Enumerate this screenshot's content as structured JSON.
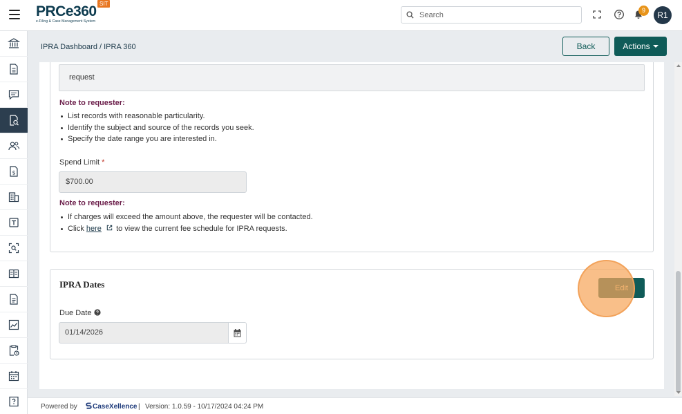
{
  "header": {
    "logo_text": "PRCe360",
    "logo_subtitle": "e-Filing & Case Management System",
    "env_badge": "SIT",
    "search_placeholder": "Search",
    "notification_count": "9",
    "avatar_initials": "R1"
  },
  "sidebar": {
    "items": [
      {
        "name": "sidebar-item-institution",
        "icon": "bank-icon"
      },
      {
        "name": "sidebar-item-documents",
        "icon": "document-icon"
      },
      {
        "name": "sidebar-item-messages",
        "icon": "chat-icon"
      },
      {
        "name": "sidebar-item-ipra",
        "icon": "file-search-icon",
        "active": true
      },
      {
        "name": "sidebar-item-users",
        "icon": "users-icon"
      },
      {
        "name": "sidebar-item-fees",
        "icon": "dollar-file-icon"
      },
      {
        "name": "sidebar-item-buildings",
        "icon": "building-icon"
      },
      {
        "name": "sidebar-item-text",
        "icon": "text-box-icon"
      },
      {
        "name": "sidebar-item-scan",
        "icon": "scan-icon"
      },
      {
        "name": "sidebar-item-library",
        "icon": "book-icon"
      },
      {
        "name": "sidebar-item-reports",
        "icon": "report-icon"
      },
      {
        "name": "sidebar-item-analytics",
        "icon": "chart-icon"
      },
      {
        "name": "sidebar-item-tasks",
        "icon": "clipboard-clock-icon"
      },
      {
        "name": "sidebar-item-calendar",
        "icon": "calendar-icon"
      },
      {
        "name": "sidebar-item-help",
        "icon": "help-book-icon"
      }
    ]
  },
  "subheader": {
    "breadcrumb": "IPRA Dashboard / IPRA 360",
    "back_label": "Back",
    "actions_label": "Actions"
  },
  "request_card": {
    "request_value": "request",
    "note1_label": "Note to requester:",
    "note1_items": [
      "List records with reasonable particularity.",
      "Identify the subject and source of the records you seek.",
      "Specify the date range you are interested in."
    ],
    "spend_limit_label": "Spend Limit",
    "required_marker": "*",
    "spend_limit_value": "$700.00",
    "note2_label": "Note to requester:",
    "note2_item1": "If charges will exceed the amount above, the requester will be contacted.",
    "note2_item2_prefix": "Click",
    "note2_item2_link": "here",
    "note2_item2_suffix": "to view the current fee schedule for IPRA requests."
  },
  "dates_card": {
    "title": "IPRA Dates",
    "edit_label": "Edit",
    "due_date_label": "Due Date",
    "due_date_value": "01/14/2026"
  },
  "footer": {
    "powered_by": "Powered by",
    "brand": "CaseXellence",
    "separator": "|",
    "version": "Version: 1.0.59 - 10/17/2024 04:24 PM"
  },
  "colors": {
    "primary": "#0f5b58",
    "note_label": "#6b1e4a",
    "badge": "#e8941a",
    "sidebar_active": "#2c3e4f"
  }
}
